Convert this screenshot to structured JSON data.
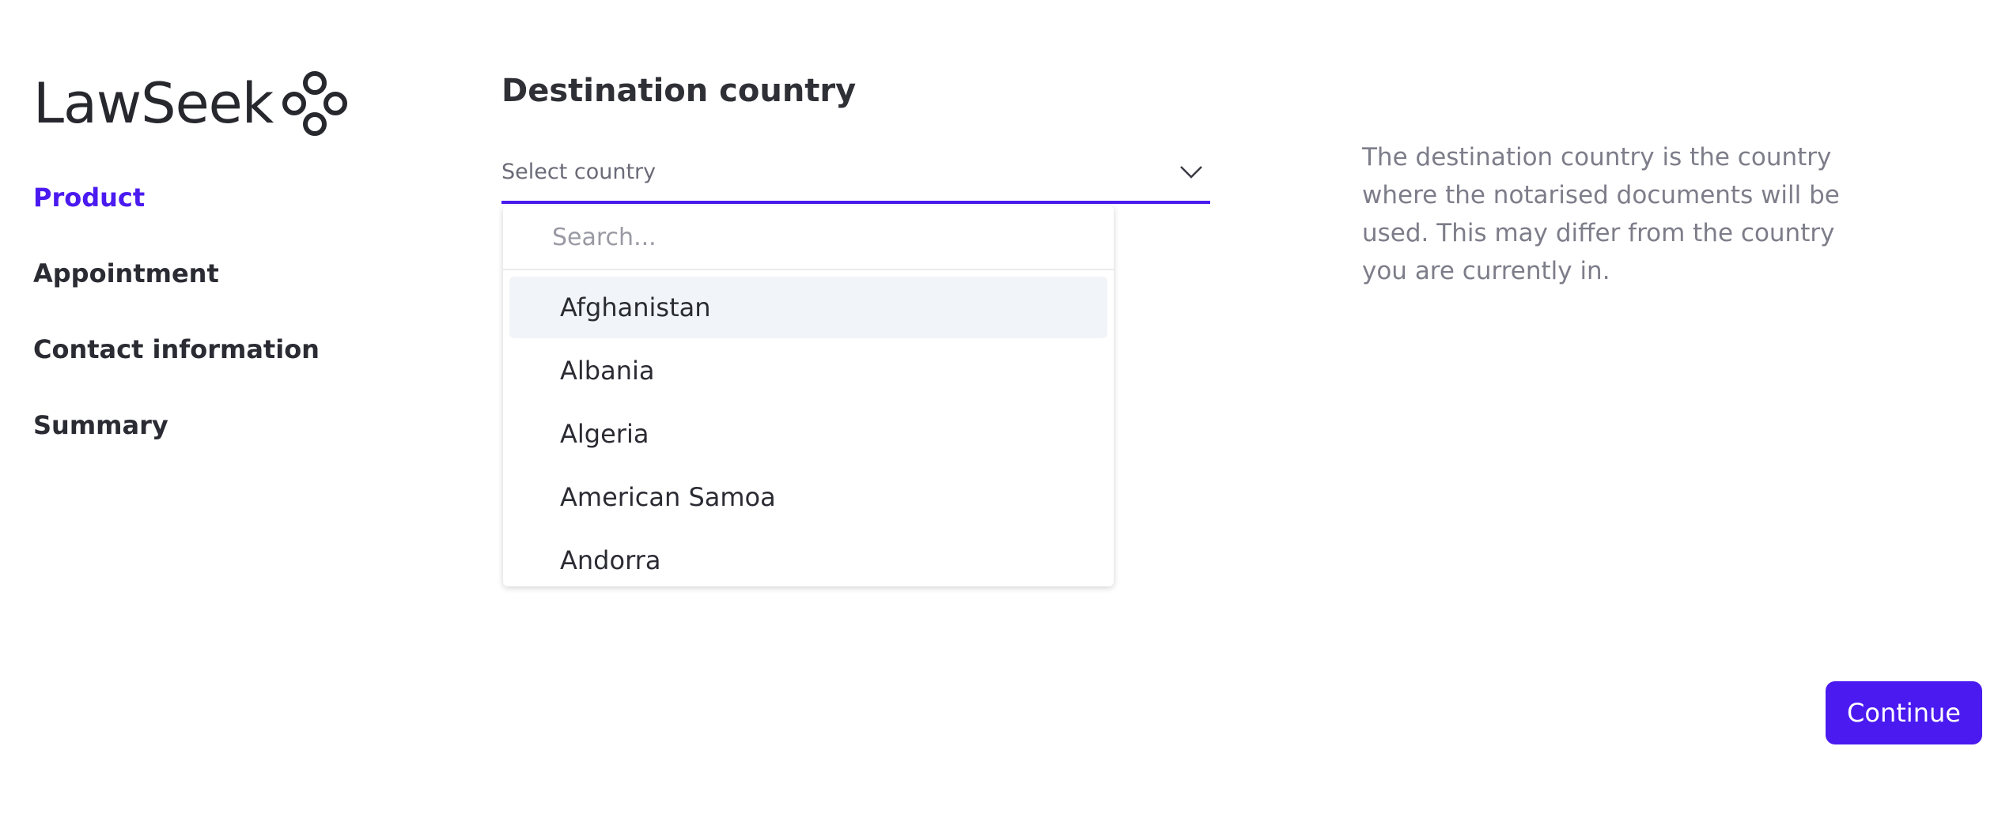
{
  "brand": {
    "name": "LawSeek",
    "logo_icon": "four-circles-icon",
    "accent_color": "#4a1af0"
  },
  "nav": {
    "items": [
      {
        "label": "Product",
        "active": true
      },
      {
        "label": "Appointment",
        "active": false
      },
      {
        "label": "Contact information",
        "active": false
      },
      {
        "label": "Summary",
        "active": false
      }
    ]
  },
  "destination": {
    "title": "Destination country",
    "select_placeholder": "Select country",
    "dropdown_icon": "chevron-down-icon",
    "search_placeholder": "Search...",
    "options": [
      "Afghanistan",
      "Albania",
      "Algeria",
      "American Samoa",
      "Andorra"
    ],
    "highlighted_option": "Afghanistan"
  },
  "help_text": "The destination country is the country where the notarised documents will be used. This may differ from the country you are currently in.",
  "actions": {
    "continue_label": "Continue"
  }
}
